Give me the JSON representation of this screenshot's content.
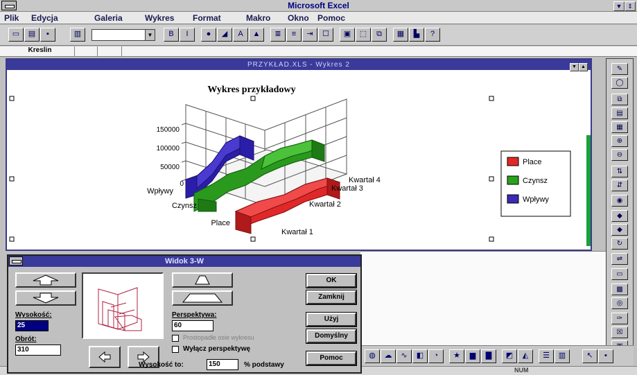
{
  "app": {
    "title": "Microsoft Excel",
    "minimize_glyph": "▼",
    "restore_glyph": "⇕"
  },
  "menu": [
    {
      "label": "Plik"
    },
    {
      "label": "Edycja"
    },
    {
      "label": "Galeria"
    },
    {
      "label": "Wykres"
    },
    {
      "label": "Format"
    },
    {
      "label": "Makro"
    },
    {
      "label": "Okno"
    },
    {
      "label": "Pomoc"
    }
  ],
  "toolbar": {
    "style_value": "",
    "buttons": [
      {
        "name": "new-icon",
        "glyph": "▭"
      },
      {
        "name": "open-icon",
        "glyph": "▤"
      },
      {
        "name": "save-icon",
        "glyph": "▪"
      },
      {
        "name": "print-icon",
        "glyph": "▥"
      },
      {
        "name": "bold-icon",
        "glyph": "B"
      },
      {
        "name": "italic-icon",
        "glyph": "I"
      },
      {
        "name": "font-size-up-icon",
        "glyph": "●"
      },
      {
        "name": "font-size-down-icon",
        "glyph": "◢"
      },
      {
        "name": "text-icon",
        "glyph": "A"
      },
      {
        "name": "align-icon",
        "glyph": "▲"
      },
      {
        "name": "sum-icon",
        "glyph": "≣"
      },
      {
        "name": "merge-icon",
        "glyph": "≡"
      },
      {
        "name": "indent-icon",
        "glyph": "⇥"
      },
      {
        "name": "border-icon",
        "glyph": "☐"
      },
      {
        "name": "frame-icon",
        "glyph": "▣"
      },
      {
        "name": "select-icon",
        "glyph": "⬚"
      },
      {
        "name": "copy-icon",
        "glyph": "⧉"
      },
      {
        "name": "paste-icon",
        "glyph": "▦"
      },
      {
        "name": "chart-wizard-icon",
        "glyph": "▙"
      },
      {
        "name": "help-icon",
        "glyph": "?"
      }
    ]
  },
  "formula_bar": {
    "name_box": "Kreslin"
  },
  "chart_window": {
    "title": "PRZYKŁAD.XLS - Wykres 2"
  },
  "chart_data": {
    "type": "area-3d",
    "title": "Wykres przykładowy",
    "categories": [
      "Kwartał 1",
      "Kwartał 2",
      "Kwartał 3",
      "Kwartał 4"
    ],
    "series": [
      {
        "name": "Place",
        "color": "#e02828",
        "values": [
          50000,
          52000,
          54000,
          55000
        ]
      },
      {
        "name": "Czynsz",
        "color": "#2aa11e",
        "values": [
          60000,
          75000,
          95000,
          110000
        ]
      },
      {
        "name": "Wpływy",
        "color": "#3a2ab4",
        "values": [
          20000,
          100000,
          140000,
          150000
        ]
      }
    ],
    "y_ticks": [
      "0",
      "50000",
      "100000",
      "150000"
    ],
    "ylim": [
      0,
      150000
    ],
    "legend_position": "right",
    "gridlines": true
  },
  "legend_items": [
    "Place",
    "Czynsz",
    "Wpływy"
  ],
  "dialog": {
    "title": "Widok 3-W",
    "elevation_label": "Wysokość:",
    "elevation_value": "25",
    "rotation_label": "Obrót:",
    "rotation_value": "310",
    "perspective_label": "Perspektywa:",
    "perspective_value": "60",
    "right_angle_axes_label": "Prostopadłe osie wykresu",
    "no_perspective_label": "Wyłącz perspektywę",
    "height_label": "Wysokość to:",
    "height_value": "150",
    "height_suffix": "% podstawy",
    "ok": "OK",
    "close": "Zamknij",
    "apply": "Użyj",
    "default": "Domyślny",
    "help": "Pomoc"
  },
  "palette": [
    "pencil-icon",
    "lasso-icon",
    "copy-chart-icon",
    "paste-chart-icon",
    "frame-chart-icon",
    "zoom-in-icon",
    "zoom-out-icon",
    "sort-asc-icon",
    "sort-desc-icon",
    "lock-icon",
    "arrow-up-icon",
    "arrow-down-icon",
    "rotate-icon",
    "align-objects-icon",
    "rectangle-icon",
    "fill-icon",
    "camera-icon",
    "brush-icon",
    "checkbox-tool-icon",
    "dialog-tool-icon"
  ],
  "palette_glyphs": [
    "✎",
    "◯",
    "⧉",
    "▤",
    "▦",
    "⊕",
    "⊖",
    "⇅",
    "⇵",
    "◉",
    "◆",
    "◆",
    "↻",
    "⇌",
    "▭",
    "▩",
    "◎",
    "✑",
    "☒",
    "▣"
  ],
  "drawbar": [
    {
      "name": "ellipse-tool-icon",
      "glyph": "◍"
    },
    {
      "name": "cloud-tool-icon",
      "glyph": "☁"
    },
    {
      "name": "curve-tool-icon",
      "glyph": "∿"
    },
    {
      "name": "chart-area-tool-icon",
      "glyph": "◧"
    },
    {
      "name": "pie-tool-icon",
      "glyph": "◔"
    },
    {
      "name": "star-tool-icon",
      "glyph": "★"
    },
    {
      "name": "bar-chart-tool-icon",
      "glyph": "▆"
    },
    {
      "name": "column-chart-tool-icon",
      "glyph": "▇"
    },
    {
      "name": "line3d-tool-icon",
      "glyph": "◩"
    },
    {
      "name": "area3d-tool-icon",
      "glyph": "◭"
    },
    {
      "name": "table-tool-icon",
      "glyph": "☰"
    },
    {
      "name": "grid-tool-icon",
      "glyph": "▥"
    },
    {
      "name": "pointer-tool-icon",
      "glyph": "↖"
    },
    {
      "name": "marker-tool-icon",
      "glyph": "▪"
    }
  ],
  "status": {
    "num": "NUM"
  }
}
